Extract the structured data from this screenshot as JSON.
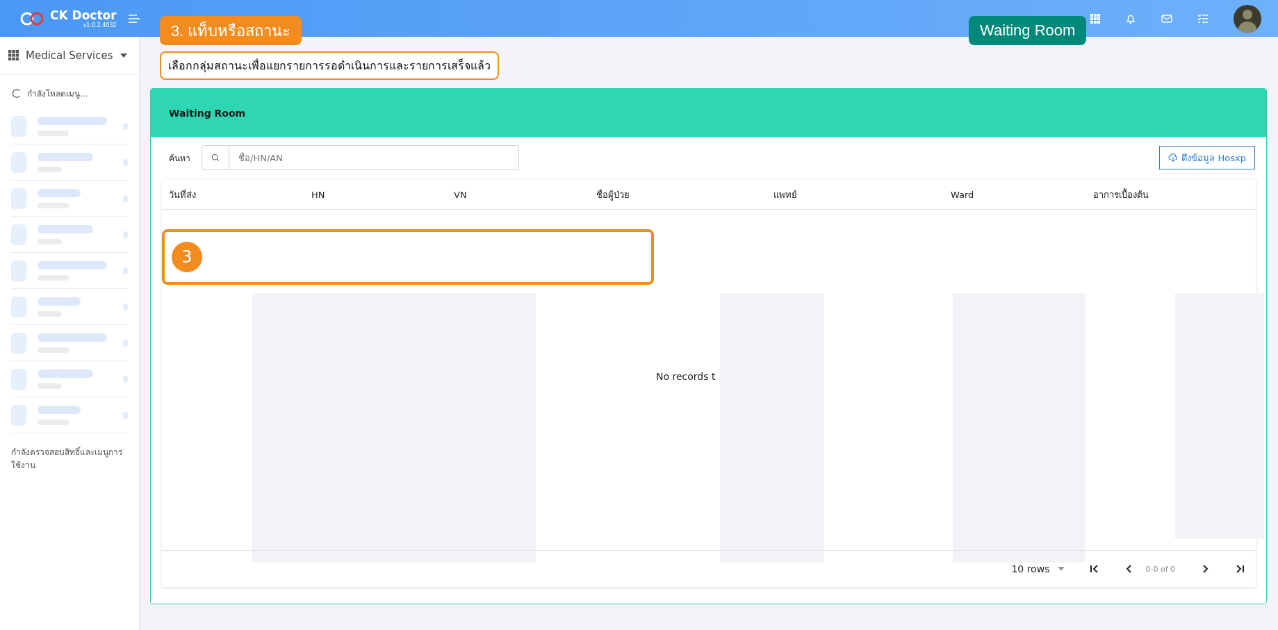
{
  "app": {
    "name": "CK Doctor",
    "version": "v1.0.2.4032"
  },
  "sidebar": {
    "menu_label": "Medical Services",
    "loading_text": "กำลังโหลดเมนู...",
    "checking_text": "กำลังตรวจสอบสิทธิ์และเมนูการใช้งาน"
  },
  "annotations": [
    {
      "kind": "tab-badge",
      "text": "3. แท็บหรือสถานะ"
    },
    {
      "kind": "page-badge",
      "text": "Waiting Room"
    },
    {
      "kind": "caption",
      "text": "เลือกกลุ่มสถานะเพื่อแยกรายการรอดำเนินการและรายการเสร็จแล้ว"
    },
    {
      "kind": "marker",
      "text": "3"
    }
  ],
  "panel": {
    "title": "Waiting Room",
    "search_label": "ค้นหา",
    "search_placeholder": "ชื่อ/HN/AN",
    "fetch_button": "ดึงข้อมูล Hosxp"
  },
  "table": {
    "columns": [
      "วันที่ส่ง",
      "HN",
      "VN",
      "ชื่อผู้ป่วย",
      "แพทย์",
      "Ward",
      "อาการเบื้องต้น"
    ],
    "empty_text": "No records t"
  },
  "pagination": {
    "rows_per_page": "10 rows",
    "range": "0-0 of 0"
  }
}
